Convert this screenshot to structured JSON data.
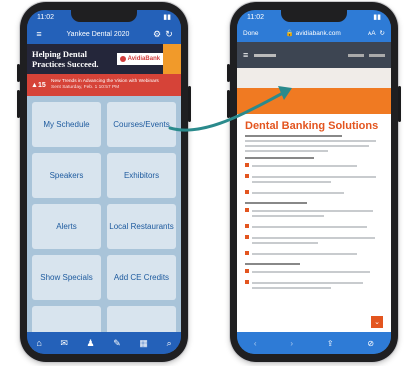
{
  "left_phone": {
    "status_time": "11:02",
    "app_title": "Yankee Dental 2020",
    "banner_headline": "Helping Dental Practices Succeed.",
    "banner_logo": "AvidiaBank",
    "banner_badge": "",
    "alert_count": "15",
    "alert_text": "New Trends in Advancing the Vision with Webinars",
    "alert_subtext": "Sent Saturday, Feb. 1 10:57 PM",
    "tiles": [
      "My Schedule",
      "Courses/Events",
      "Speakers",
      "Exhibitors",
      "Alerts",
      "Local Restaurants",
      "Show Specials",
      "Add CE Credits",
      "",
      ""
    ],
    "tabbar_icons": [
      "home-icon",
      "ticket-icon",
      "person-icon",
      "chat-icon",
      "calendar-icon",
      "search-icon"
    ],
    "tabbar_glyphs": [
      "⌂",
      "✉",
      "♟",
      "✎",
      "▦",
      "⌕"
    ]
  },
  "right_phone": {
    "status_time": "11:02",
    "done_label": "Done",
    "url": "avidiabank.com",
    "page_heading": "Dental Banking Solutions",
    "tabbar_glyphs": [
      "‹",
      "›",
      "⇪",
      "⊘"
    ]
  },
  "colors": {
    "app_blue": "#2461b9",
    "alert_red": "#d64338",
    "browser_orange": "#f07a22",
    "arrow_teal": "#2a8a8c"
  }
}
